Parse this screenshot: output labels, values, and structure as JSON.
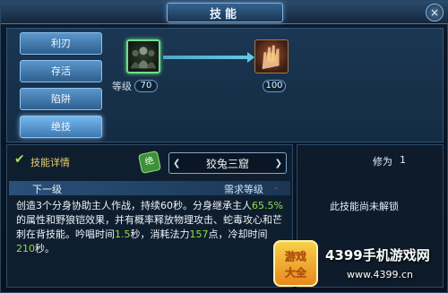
{
  "window": {
    "title": "技能",
    "close_label": "×"
  },
  "tabs": [
    {
      "label": "利刃",
      "active": false
    },
    {
      "label": "存活",
      "active": false
    },
    {
      "label": "陷阱",
      "active": false
    },
    {
      "label": "绝技",
      "active": true
    }
  ],
  "skill_tree": {
    "level_label": "等级",
    "skill_current_level": "70",
    "skill_next_level": "100",
    "icons": [
      "shadow-clone-icon",
      "fire-hands-icon"
    ]
  },
  "detail": {
    "label": "技能详情",
    "badge": "绝",
    "skill_name": "狡兔三窟",
    "next_level_label": "下一级",
    "required_level_label": "需求等级",
    "required_level_value": "-",
    "desc_parts": [
      {
        "text": "创造3个分身协助主人作战，持续60秒。分身继承主人",
        "hl": false
      },
      {
        "text": "65.5%",
        "hl": true
      },
      {
        "text": "的属性和野狼铠效果，并有概率释放物理攻击、蛇毒攻心和芒刺在背技能。吟唱时间",
        "hl": false
      },
      {
        "text": "1.5",
        "hl": true
      },
      {
        "text": "秒，消耗法力",
        "hl": false
      },
      {
        "text": "157",
        "hl": true
      },
      {
        "text": "点，冷却时间",
        "hl": false
      },
      {
        "text": "210",
        "hl": true
      },
      {
        "text": "秒。",
        "hl": false
      }
    ]
  },
  "right_panel": {
    "mastery_label": "修为",
    "mastery_value": "1",
    "locked_text": "此技能尚未解锁"
  },
  "watermark": {
    "logo_text": "游戏大全",
    "site_name": "4399手机游戏网",
    "site_url": "www.4399.cn"
  },
  "colors": {
    "highlight": "#8fe045",
    "required_level": "#d74b3a",
    "tab": "#4f8cc2"
  }
}
